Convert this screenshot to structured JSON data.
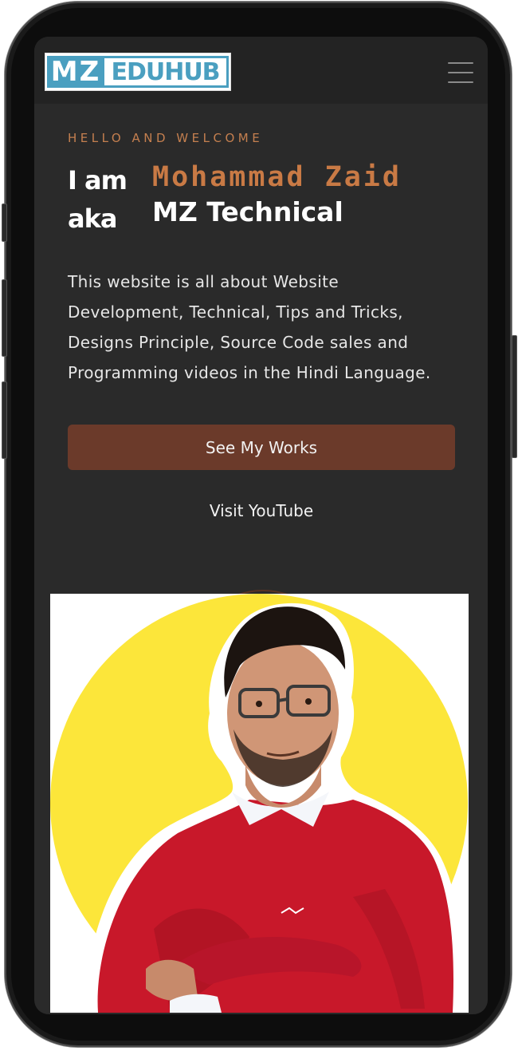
{
  "logo": {
    "part1": "MZ",
    "part2": "EDUHUB"
  },
  "hero": {
    "greeting": "HELLO AND WELCOME",
    "intro_line1": "I am",
    "intro_line2": "aka",
    "name": "Mohammad Zaid",
    "alias": "MZ Technical",
    "description": "This website is all about Website Development, Technical, Tips and Tricks, Designs Principle, Source Code sales and Programming videos in the Hindi Language."
  },
  "actions": {
    "works_label": "See My Works",
    "youtube_label": "Visit YouTube"
  },
  "colors": {
    "background": "#2a2a2a",
    "accent": "#c47f4f",
    "button": "#6b3a2a",
    "logo_blue": "#4a9fc0",
    "photo_bg": "#fce63a",
    "sweater": "#c8182a"
  },
  "icons": {
    "menu": "hamburger-menu-icon"
  }
}
